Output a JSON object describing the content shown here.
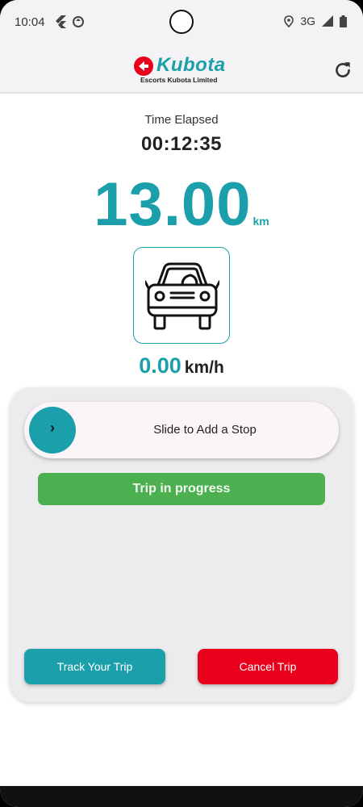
{
  "status_bar": {
    "time": "10:04",
    "network": "3G",
    "icons": [
      "flutter-icon",
      "sync-icon",
      "location-icon",
      "signal-icon",
      "battery-icon"
    ]
  },
  "app_bar": {
    "logo_word": "Kubota",
    "logo_subtitle": "Escorts Kubota Limited",
    "refresh_icon": "refresh-icon"
  },
  "trip": {
    "time_label": "Time Elapsed",
    "time_value": "00:12:35",
    "distance_value": "13.00",
    "distance_unit": "km",
    "vehicle_icon": "car-icon",
    "speed_value": "0.00",
    "speed_unit": "km/h"
  },
  "panel": {
    "slider_knob_icon": "chevron-right-icon",
    "slider_knob_glyph": "›",
    "slider_label": "Slide to Add a Stop",
    "status_label": "Trip in progress",
    "track_button": "Track Your Trip",
    "cancel_button": "Cancel Trip"
  },
  "colors": {
    "brand_teal": "#1b9fab",
    "brand_red": "#e8001c",
    "status_green": "#4caf50"
  }
}
